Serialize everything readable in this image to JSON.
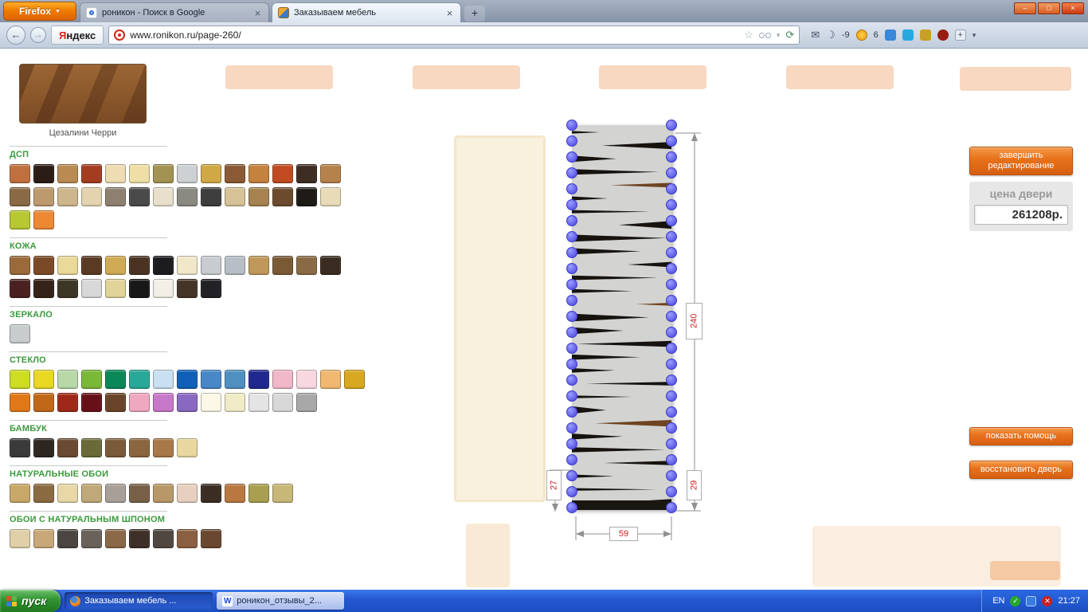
{
  "browser": {
    "firefox_label": "Firefox",
    "tabs": [
      {
        "title": "роникон - Поиск в Google"
      },
      {
        "title": "Заказываем мебель"
      }
    ],
    "url": "www.ronikon.ru/page-260/",
    "yandex_first": "Я",
    "yandex_rest": "ндекс",
    "weather_temp": "-9",
    "notif_count": "6"
  },
  "icons": {
    "dropdown": "▼",
    "chevron_small": "▾",
    "close": "×",
    "back": "←",
    "forward": "→",
    "star": "☆",
    "refresh": "⟳",
    "mail": "✉",
    "moon": "☽",
    "new_tab": "+",
    "minimize": "–",
    "maximize": "□",
    "word": "W",
    "check": "✓",
    "cross": "✕"
  },
  "sidebar": {
    "preview_caption": "Цезалини Черри",
    "sections": [
      {
        "title": "ДСП",
        "rows": [
          [
            "#c0703f",
            "#2b1c15",
            "#b98a52",
            "#a43c20",
            "#eedcb2",
            "#eedfa6",
            "#a39352",
            "#ced1d3",
            "#d0a845",
            "#8a5a34",
            "#c5813e",
            "#c04b20",
            "#3d2d22",
            "#b5824c"
          ],
          [
            "#8a6a45",
            "#bc9a6d",
            "#cdb68c",
            "#e3d3ae",
            "#8e8070",
            "#4a4a4a",
            "#e8e0cc",
            "#8a8a82",
            "#3e3e3e",
            "#d6c296",
            "#a5824f",
            "#6b4a2e",
            "#1e1a16",
            "#e8dcb8"
          ],
          [
            "#b8c832",
            "#ee8833"
          ]
        ]
      },
      {
        "title": "КОЖА",
        "rows": [
          [
            "#9a6a3a",
            "#7a4a28",
            "#eada9a",
            "#5a3a22",
            "#d0aa55",
            "#4a3322",
            "#1c1c1e",
            "#f0e8c8",
            "#c8ccd0",
            "#b8bec6",
            "#c0985a",
            "#7a5a35",
            "#8a6a45",
            "#3a2c20"
          ],
          [
            "#4a2020",
            "#352218",
            "#3c3626",
            "#d8d8d8",
            "#e0d498",
            "#181818",
            "#f2efe6",
            "#453528",
            "#222226"
          ]
        ]
      },
      {
        "title": "ЗЕРКАЛО",
        "rows": [
          [
            "#c8cccc"
          ]
        ]
      },
      {
        "title": "СТЕКЛО",
        "rows": [
          [
            "#ccdd22",
            "#e8d822",
            "#b8d8a8",
            "#7ab838",
            "#0a8858",
            "#28a898",
            "#c8e0f0",
            "#1060b8",
            "#4888c8",
            "#5090c0",
            "#202890",
            "#f0b8c8",
            "#f8d8e0",
            "#f0b870",
            "#d8a820"
          ],
          [
            "#e07818",
            "#c06818",
            "#a02818",
            "#681018",
            "#6a4428",
            "#f0a8c0",
            "#c878c8",
            "#8868c0",
            "#fcf8e8",
            "#f0ecc8",
            "#e4e4e4",
            "#d8d8d8",
            "#a8a8a8"
          ]
        ]
      },
      {
        "title": "БАМБУК",
        "rows": [
          [
            "#3a3a3a",
            "#2e2620",
            "#6a4a30",
            "#6a6a38",
            "#7a5a38",
            "#8a6540",
            "#a87848",
            "#e8d8a0"
          ]
        ]
      },
      {
        "title": "НАТУРАЛЬНЫЕ ОБОИ",
        "rows": [
          [
            "#c8a868",
            "#8a6a40",
            "#e8d8a8",
            "#c0a878",
            "#a8a098",
            "#786048",
            "#b89868",
            "#e8d0c0",
            "#3a2e24",
            "#b87840",
            "#a8a050",
            "#c8b878"
          ]
        ]
      },
      {
        "title": "ОБОИ С НАТУРАЛЬНЫМ ШПОНОМ",
        "rows": [
          [
            "#e0d0a8",
            "#c8a878",
            "#4a4540",
            "#6a625a",
            "#8a6848",
            "#3e3028",
            "#504840",
            "#8a6040",
            "#6a4830"
          ]
        ]
      }
    ]
  },
  "editor": {
    "dims": {
      "height": "240",
      "bottom_left": "27",
      "bottom_right": "29",
      "width": "59"
    }
  },
  "panel": {
    "finish_label": "завершить редактирование",
    "price_label": "цена двери",
    "price_value": "261208р.",
    "help_label": "показать помощь",
    "restore_label": "восстановить дверь"
  },
  "taskbar": {
    "start_label": "пуск",
    "tasks": [
      {
        "title": "Заказываем мебель ..."
      },
      {
        "title": "роникон_отзывы_2..."
      }
    ],
    "language": "EN",
    "time": "21:27"
  },
  "colors": {
    "accent_orange": "#e8731e",
    "title_green": "#3a9a3c",
    "dim_red": "#cc2020",
    "taskbar_blue": "#2a5ade",
    "start_green": "#3c9e3c",
    "handle_blue": "#6a6af0"
  }
}
